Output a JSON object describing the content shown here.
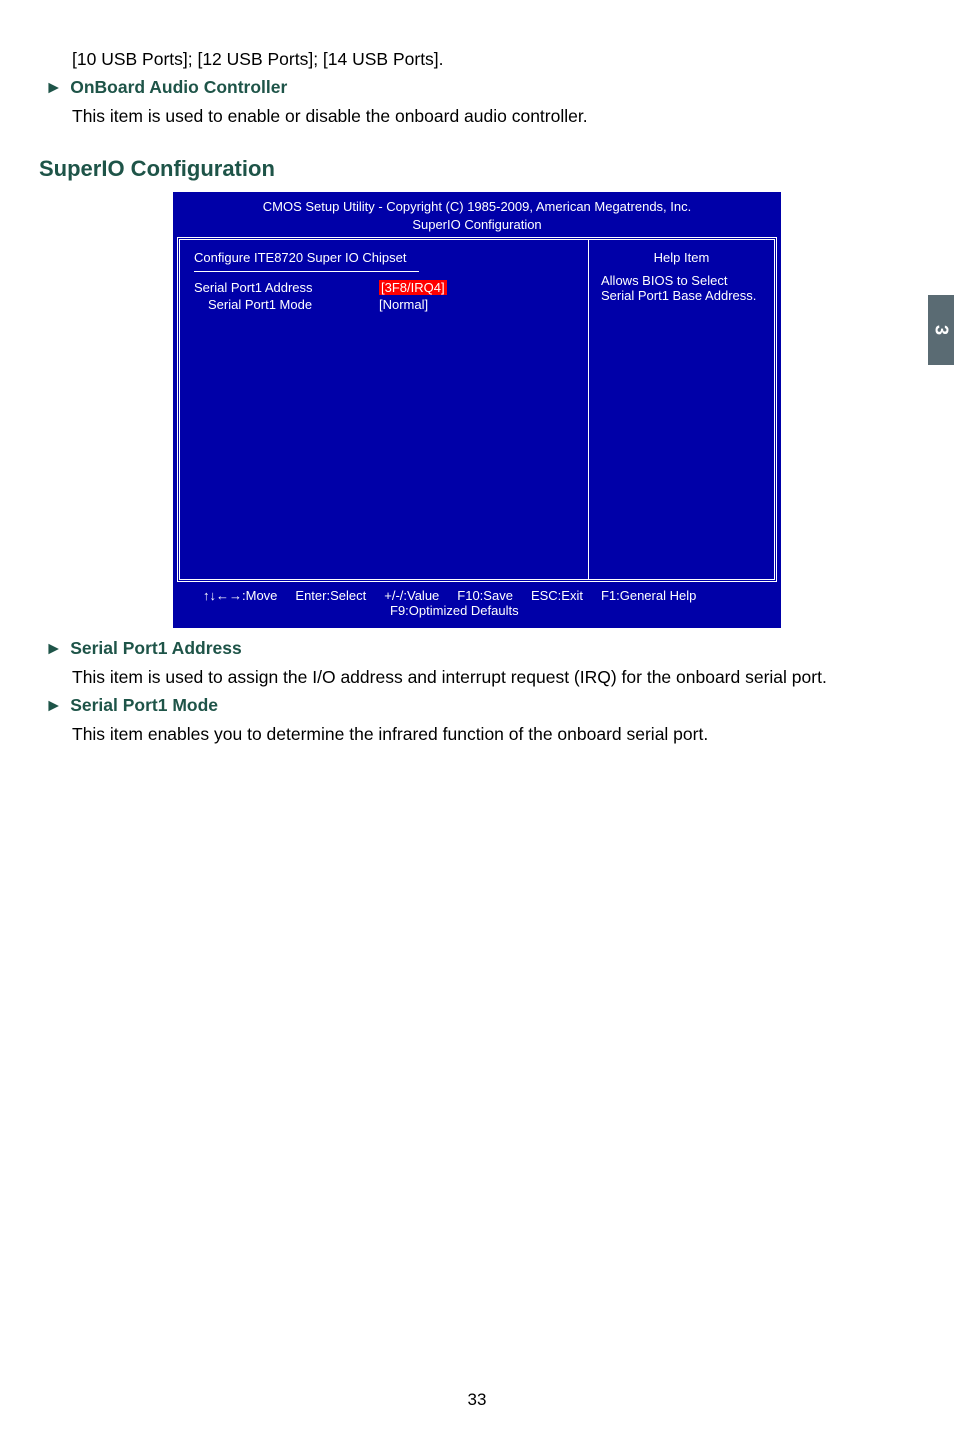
{
  "sidebar": {
    "label": "3"
  },
  "topline": "[10 USB Ports]; [12 USB Ports]; [14 USB Ports].",
  "item_onboard_audio": {
    "title": "OnBoard Audio Controller",
    "desc": "This item is used to enable or disable the onboard audio controller."
  },
  "section": {
    "title": "SuperIO Configuration"
  },
  "bios": {
    "header_line1": "CMOS Setup Utility - Copyright (C) 1985-2009, American Megatrends, Inc.",
    "header_line2": "SuperIO Configuration",
    "config_title": "Configure ITE8720 Super IO Chipset",
    "help_header": "Help Item",
    "rows": [
      {
        "label": "Serial Port1 Address",
        "value": "[3F8/IRQ4]",
        "highlight": true
      },
      {
        "label": "Serial Port1 Mode",
        "value": "[Normal]",
        "indent": true
      }
    ],
    "help_text": "Allows BIOS to Select Serial Port1 Base Address.",
    "footer": {
      "move": "↑↓←→:Move",
      "enter": "Enter:Select",
      "value": "+/-/:Value",
      "f10": "F10:Save",
      "esc": "ESC:Exit",
      "f1": "F1:General Help",
      "f9": "F9:Optimized Defaults"
    }
  },
  "item_serial_addr": {
    "title": "Serial Port1 Address",
    "desc": "This item is used to assign the I/O address and interrupt request (IRQ) for the onboard serial port."
  },
  "item_serial_mode": {
    "title": "Serial Port1 Mode",
    "desc": "This item enables you to determine the infrared function of the onboard serial port."
  },
  "page_number": "33",
  "arrow": "►"
}
